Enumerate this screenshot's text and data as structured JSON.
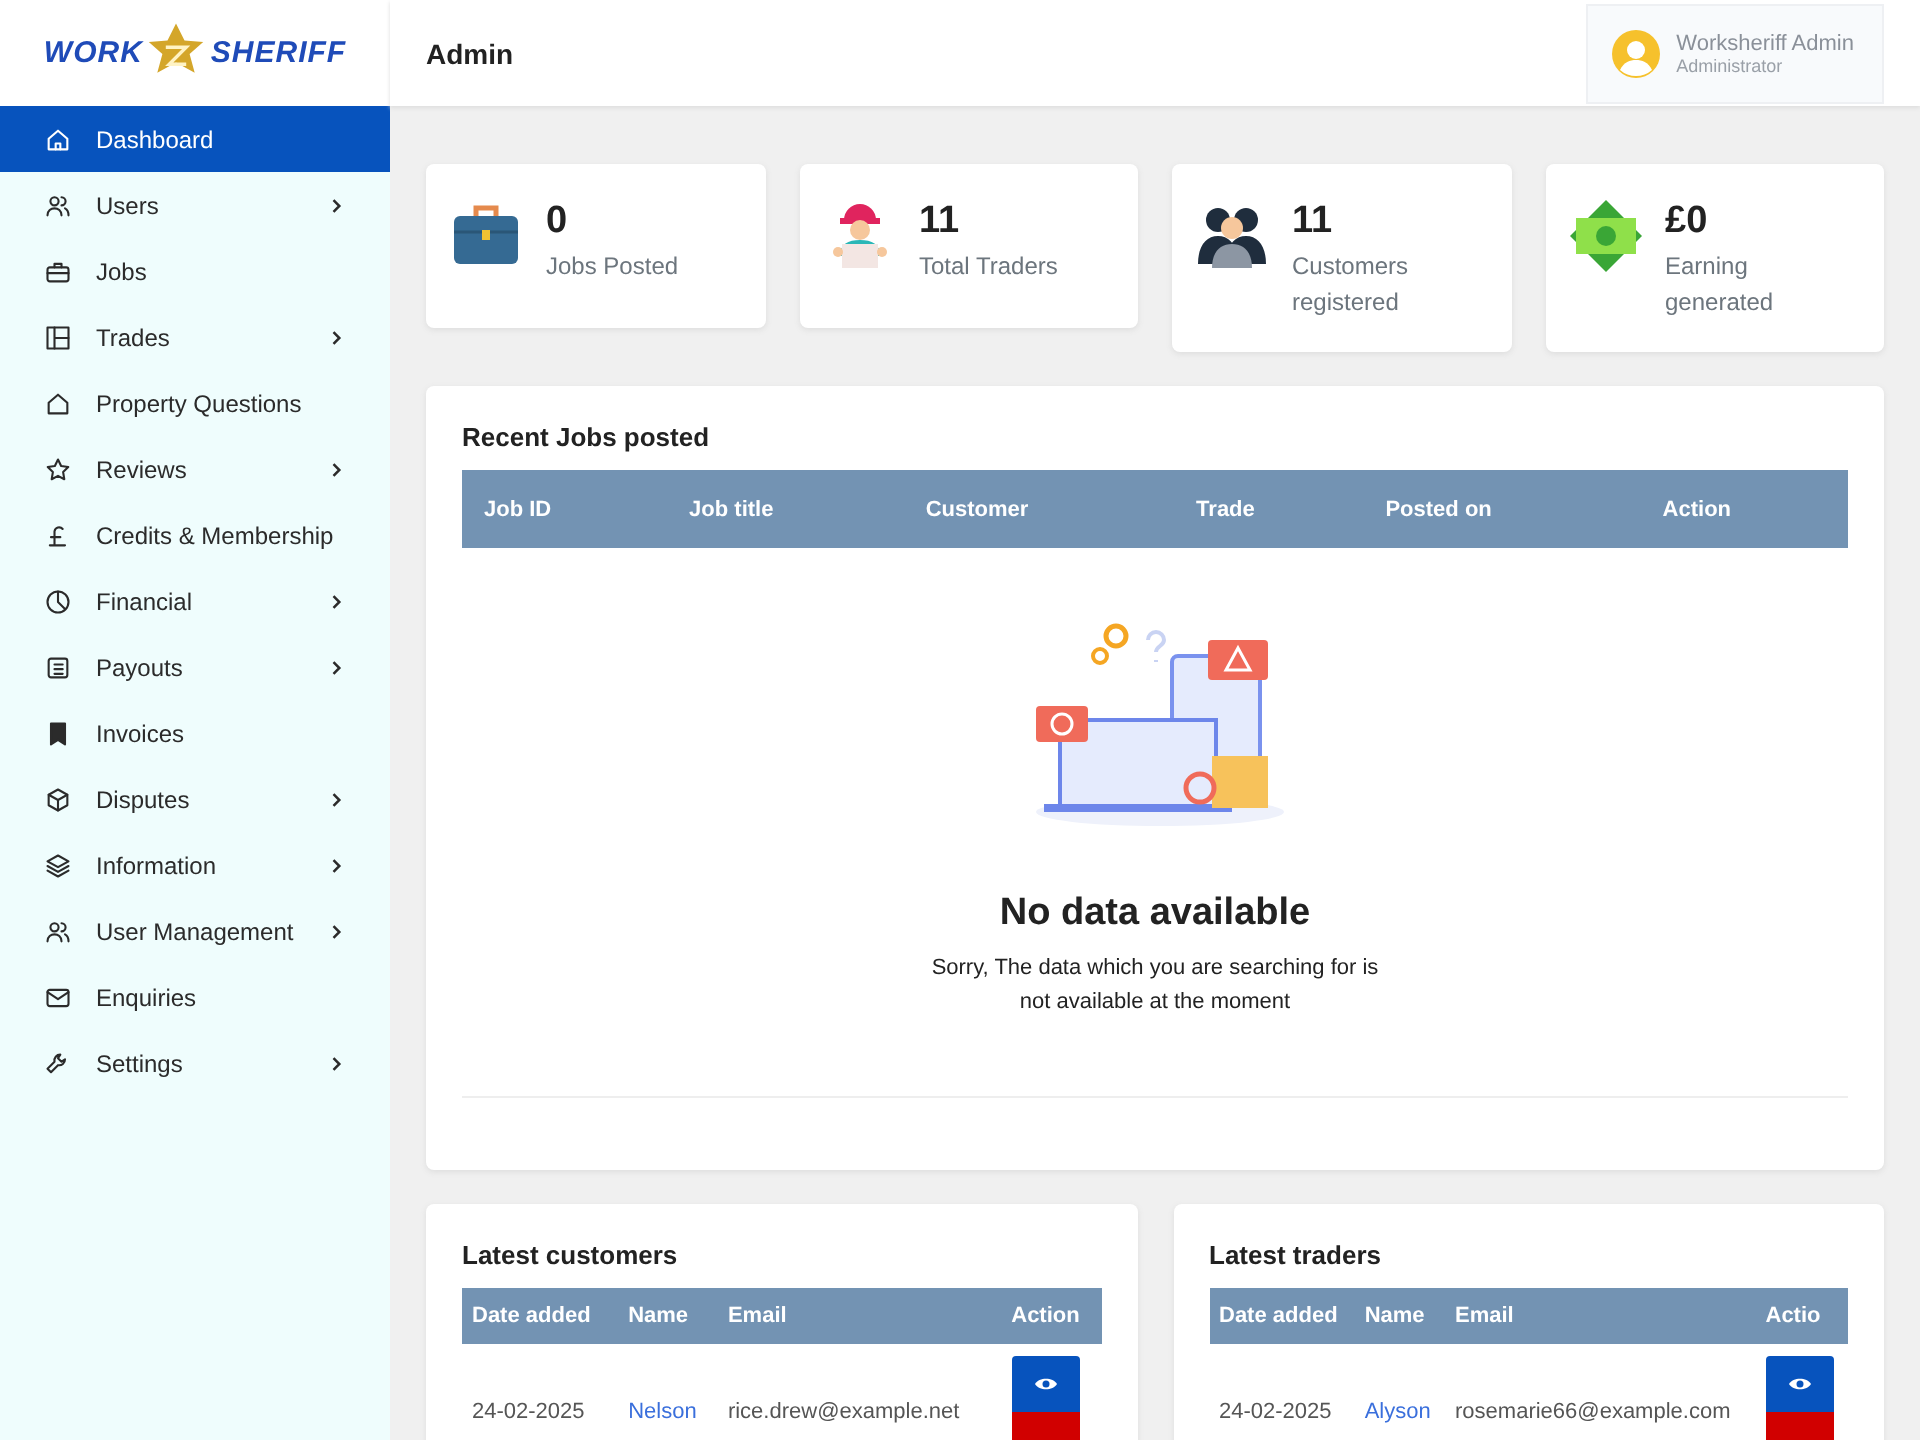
{
  "logo": {
    "left": "WORK",
    "right": "SHERIFF"
  },
  "header": {
    "title": "Admin",
    "user": {
      "name": "Worksheriff Admin",
      "role": "Administrator"
    }
  },
  "sidebar": {
    "items": [
      {
        "label": "Dashboard",
        "selected": true,
        "has_submenu": false
      },
      {
        "label": "Users",
        "selected": false,
        "has_submenu": true
      },
      {
        "label": "Jobs",
        "selected": false,
        "has_submenu": false
      },
      {
        "label": "Trades",
        "selected": false,
        "has_submenu": true
      },
      {
        "label": "Property Questions",
        "selected": false,
        "has_submenu": false
      },
      {
        "label": "Reviews",
        "selected": false,
        "has_submenu": true
      },
      {
        "label": "Credits & Membership",
        "selected": false,
        "has_submenu": false
      },
      {
        "label": "Financial",
        "selected": false,
        "has_submenu": true
      },
      {
        "label": "Payouts",
        "selected": false,
        "has_submenu": true
      },
      {
        "label": "Invoices",
        "selected": false,
        "has_submenu": false
      },
      {
        "label": "Disputes",
        "selected": false,
        "has_submenu": true
      },
      {
        "label": "Information",
        "selected": false,
        "has_submenu": true
      },
      {
        "label": "User Management",
        "selected": false,
        "has_submenu": true
      },
      {
        "label": "Enquiries",
        "selected": false,
        "has_submenu": false
      },
      {
        "label": "Settings",
        "selected": false,
        "has_submenu": true
      }
    ]
  },
  "stats": [
    {
      "value": "0",
      "label": "Jobs Posted"
    },
    {
      "value": "11",
      "label": "Total Traders"
    },
    {
      "value": "11",
      "label": "Customers registered"
    },
    {
      "value": "£0",
      "label": "Earning generated"
    }
  ],
  "recent_jobs": {
    "title": "Recent Jobs posted",
    "columns": [
      "Job ID",
      "Job title",
      "Customer",
      "Trade",
      "Posted on",
      "Action"
    ],
    "empty": {
      "title": "No data available",
      "message": "Sorry, The data which you are searching for is not available at the moment"
    }
  },
  "latest_customers": {
    "title": "Latest customers",
    "columns": [
      "Date added",
      "Name",
      "Email",
      "Action"
    ],
    "rows": [
      {
        "date": "24-02-2025",
        "name": "Nelson",
        "email": "rice.drew@example.net"
      }
    ]
  },
  "latest_traders": {
    "title": "Latest traders",
    "columns": [
      "Date added",
      "Name",
      "Email",
      "Actio"
    ],
    "rows": [
      {
        "date": "24-02-2025",
        "name": "Alyson",
        "email": "rosemarie66@example.com"
      }
    ]
  }
}
